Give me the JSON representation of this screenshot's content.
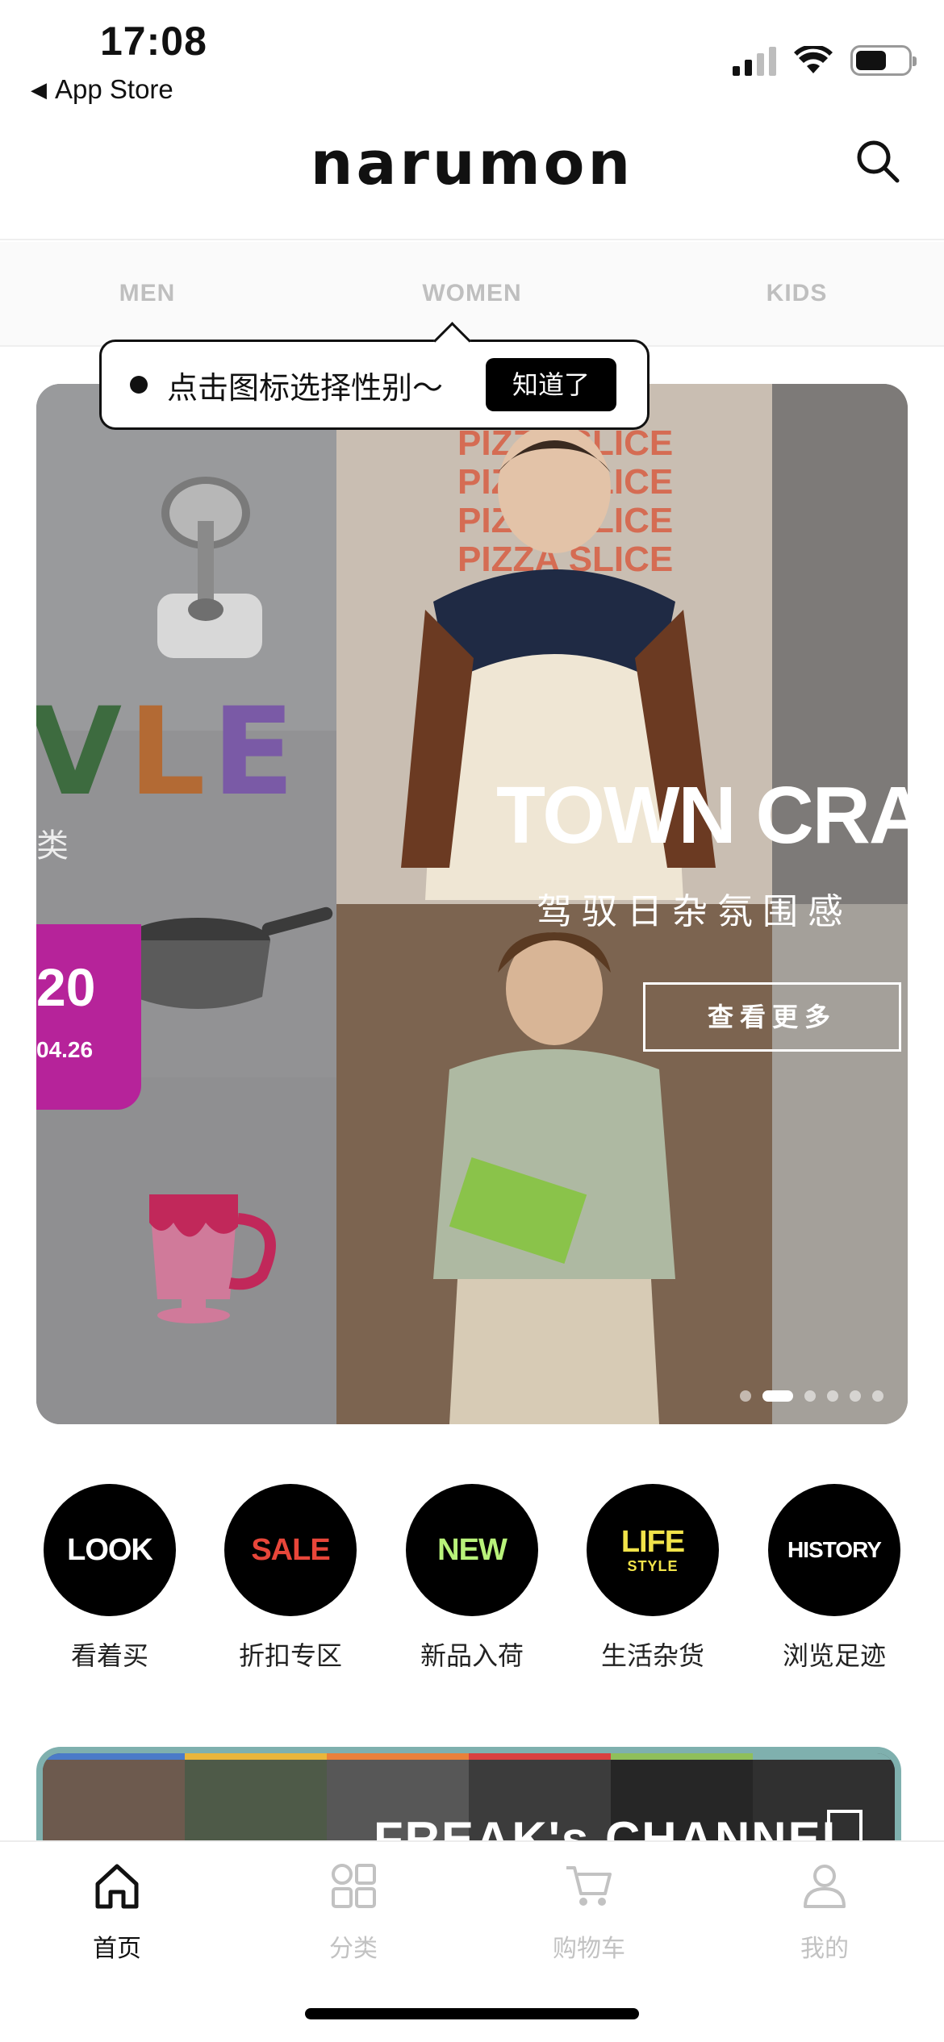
{
  "status_bar": {
    "time": "17:08",
    "back_label": "App Store",
    "signal_bars_active": 2
  },
  "header": {
    "logo": "narumon",
    "search_icon": "search-icon"
  },
  "gender_tabs": [
    {
      "label": "MEN"
    },
    {
      "label": "WOMEN"
    },
    {
      "label": "KIDS"
    }
  ],
  "tooltip": {
    "text": "点击图标选择性别～",
    "button_label": "知道了"
  },
  "hero": {
    "left_text": "VLE",
    "left_side_mark": "类",
    "sale_number": "20",
    "sale_date": "04.26",
    "pizza_text": [
      "PIZZA SLICE",
      "PIZZA SLICE",
      "PIZZA SLICE",
      "PIZZA SLICE"
    ],
    "title": "TOWN CRA",
    "subtitle": "驾驭日杂氛围感",
    "cta_label": "查看更多",
    "slide_count": 6,
    "active_slide": 2
  },
  "quick_nav": [
    {
      "badge": "LOOK",
      "badge_color": "#ffffff",
      "label": "看着买"
    },
    {
      "badge": "SALE",
      "badge_color": "#e8463a",
      "label": "折扣专区"
    },
    {
      "badge": "NEW",
      "badge_color": "#b8f27a",
      "label": "新品入荷"
    },
    {
      "badge": "LIFE",
      "badge_sub": "STYLE",
      "badge_color": "#f1e34a",
      "label": "生活杂货"
    },
    {
      "badge": "HISTORY",
      "badge_color": "#ffffff",
      "label": "浏览足迹"
    }
  ],
  "channel_banner": {
    "title": "FREAK's CHANNEL",
    "stripe_colors": [
      "#4b7bc8",
      "#e9b63b",
      "#e9813b",
      "#d94040",
      "#8fbf5a",
      "#7fb0ae"
    ]
  },
  "tabbar": [
    {
      "label": "首页",
      "icon": "home-icon",
      "active": true
    },
    {
      "label": "分类",
      "icon": "category-icon",
      "active": false
    },
    {
      "label": "购物车",
      "icon": "cart-icon",
      "active": false
    },
    {
      "label": "我的",
      "icon": "profile-icon",
      "active": false
    }
  ],
  "colors": {
    "accent": "#000000",
    "inactive": "#c2c2c2",
    "sale_card": "#b6239a"
  }
}
